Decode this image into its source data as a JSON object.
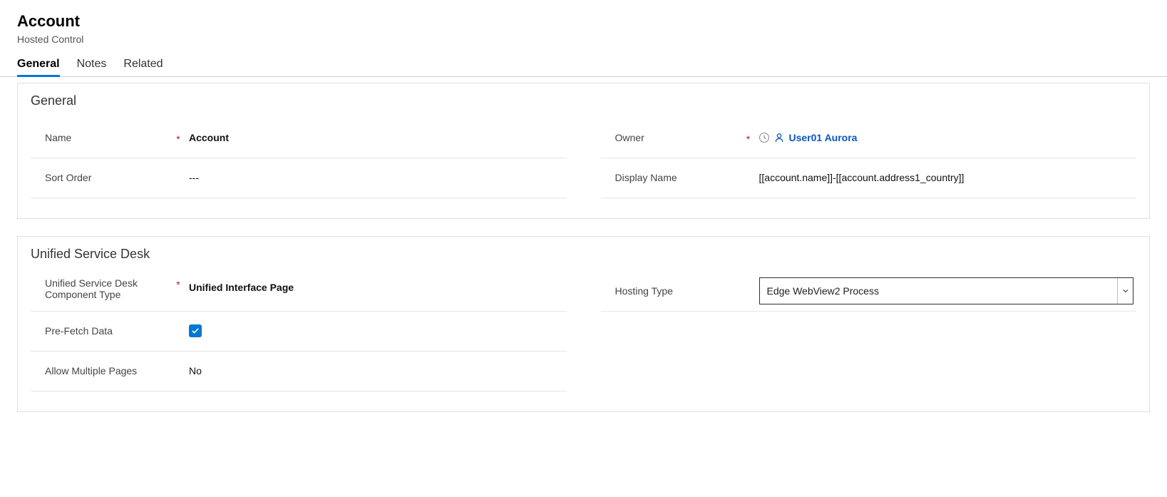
{
  "header": {
    "title": "Account",
    "subtitle": "Hosted Control"
  },
  "tabs": [
    {
      "id": "general",
      "label": "General",
      "active": true
    },
    {
      "id": "notes",
      "label": "Notes",
      "active": false
    },
    {
      "id": "related",
      "label": "Related",
      "active": false
    }
  ],
  "sections": {
    "general": {
      "title": "General",
      "fields": {
        "name": {
          "label": "Name",
          "value": "Account",
          "required": true
        },
        "sortOrder": {
          "label": "Sort Order",
          "value": "---"
        },
        "owner": {
          "label": "Owner",
          "value": "User01 Aurora",
          "required": true
        },
        "displayName": {
          "label": "Display Name",
          "value": "[[account.name]]-[[account.address1_country]]"
        }
      }
    },
    "usd": {
      "title": "Unified Service Desk",
      "fields": {
        "componentType": {
          "label": "Unified Service Desk Component Type",
          "value": "Unified Interface Page",
          "required": true
        },
        "preFetch": {
          "label": "Pre-Fetch Data",
          "checked": true
        },
        "allowMulti": {
          "label": "Allow Multiple Pages",
          "value": "No"
        },
        "hostingType": {
          "label": "Hosting Type",
          "value": "Edge WebView2 Process"
        }
      }
    }
  }
}
